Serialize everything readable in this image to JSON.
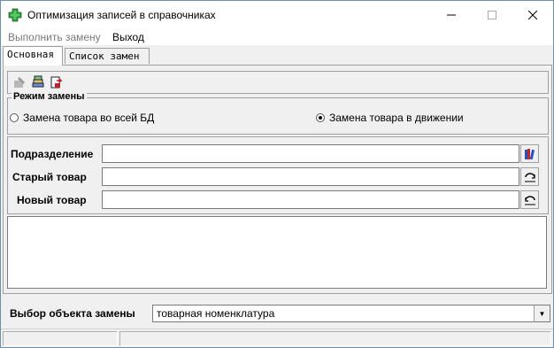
{
  "window": {
    "title": "Оптимизация записей в справочниках"
  },
  "menu": {
    "items": [
      {
        "label": "Выполнить замену",
        "disabled": true
      },
      {
        "label": "Выход",
        "disabled": false
      }
    ]
  },
  "tabs": [
    {
      "label": "Основная",
      "active": true
    },
    {
      "label": "Список замен",
      "active": false
    }
  ],
  "mode_group": {
    "legend": "Режим замены",
    "options": [
      {
        "label": "Замена товара во всей БД",
        "selected": false
      },
      {
        "label": "Замена товара в движении",
        "selected": true
      }
    ]
  },
  "fields": {
    "division": {
      "label": "Подразделение",
      "value": ""
    },
    "old_item": {
      "label": "Старый товар",
      "value": ""
    },
    "new_item": {
      "label": "Новый товар",
      "value": ""
    }
  },
  "replace_object": {
    "label": "Выбор объекта замены",
    "value": "товарная номенклатура"
  },
  "colors": {
    "accent_green": "#2e9b3a",
    "border": "#a0a0a0"
  }
}
